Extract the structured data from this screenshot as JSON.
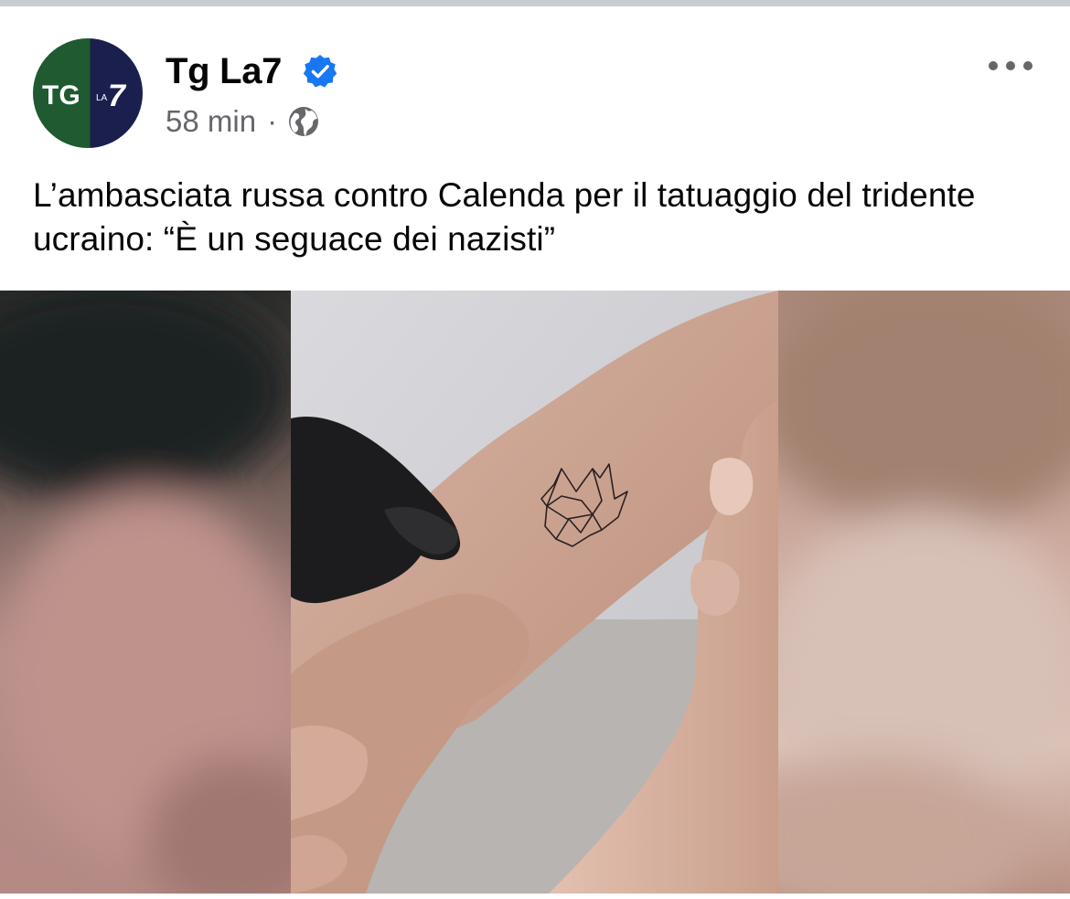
{
  "post": {
    "author": "Tg La7",
    "verified": true,
    "time": "58 min",
    "separator": "·",
    "audience_icon": "globe-icon",
    "more_icon": "more-options-icon",
    "caption": "L’ambasciata russa contro Calenda per il tatuaggio del tridente ucraino: “È un seguace dei nazisti”"
  },
  "avatar": {
    "logo_text_main": "TG",
    "logo_text_small": "LA",
    "logo_text_number": "7",
    "colors": {
      "left": "#1f5a30",
      "right": "#1a1f4e"
    }
  },
  "colors": {
    "verified_badge": "#1877f2",
    "meta_text": "#65676b",
    "divider": "#c9ccd1"
  }
}
